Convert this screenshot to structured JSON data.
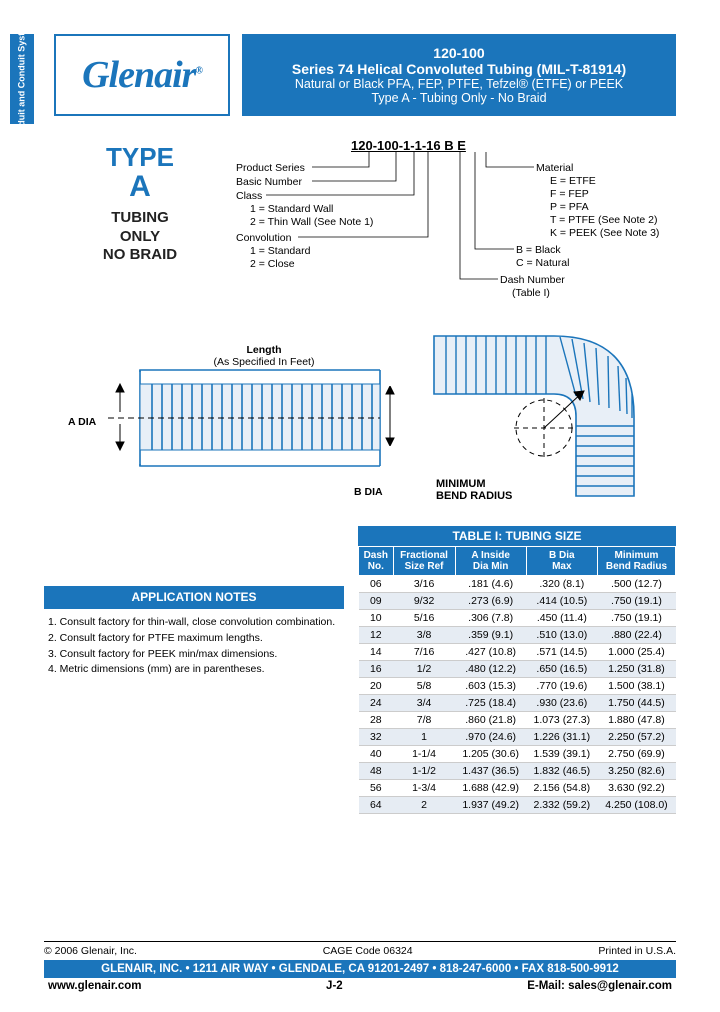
{
  "sideTab": "Conduit and\nConduit\nSystems",
  "logo": "Glenair",
  "logoReg": "®",
  "title": {
    "l1": "120-100",
    "l2": "Series 74 Helical Convoluted Tubing (MIL-T-81914)",
    "l3": "Natural or Black PFA, FEP, PTFE, Tefzel® (ETFE) or PEEK",
    "l4": "Type A - Tubing Only - No Braid"
  },
  "typeA": {
    "line1": "TYPE",
    "line2": "A",
    "line3": "TUBING",
    "line4": "ONLY",
    "line5": "NO BRAID"
  },
  "pn": {
    "example": "120-100-1-1-16 B E",
    "labels": {
      "productSeries": "Product Series",
      "basicNumber": "Basic Number",
      "class": "Class",
      "class1": "1 = Standard Wall",
      "class2": "2 = Thin Wall (See Note 1)",
      "convolution": "Convolution",
      "conv1": "1 = Standard",
      "conv2": "2 = Close",
      "material": "Material",
      "matE": "E = ETFE",
      "matF": "F = FEP",
      "matP": "P = PFA",
      "matT": "T = PTFE (See Note 2)",
      "matK": "K = PEEK (See Note 3)",
      "colorB": "B = Black",
      "colorC": "C = Natural",
      "dashNum": "Dash Number",
      "dashNumRef": "(Table I)"
    }
  },
  "diag": {
    "lengthLabel": "Length",
    "lengthSub": "(As Specified In Feet)",
    "aDia": "A DIA",
    "bDia": "B DIA",
    "bendLabel": "MINIMUM\nBEND RADIUS"
  },
  "notes": {
    "header": "APPLICATION NOTES",
    "items": [
      "1. Consult factory for thin-wall, close convolution combination.",
      "2. Consult factory for PTFE maximum lengths.",
      "3. Consult factory for PEEK min/max dimensions.",
      "4. Metric dimensions (mm) are in parentheses."
    ]
  },
  "table": {
    "caption": "TABLE I: TUBING SIZE",
    "headers": [
      "Dash\nNo.",
      "Fractional\nSize Ref",
      "A Inside\nDia Min",
      "B Dia\nMax",
      "Minimum\nBend Radius"
    ],
    "rows": [
      [
        "06",
        "3/16",
        ".181 (4.6)",
        ".320 (8.1)",
        ".500 (12.7)"
      ],
      [
        "09",
        "9/32",
        ".273 (6.9)",
        ".414 (10.5)",
        ".750 (19.1)"
      ],
      [
        "10",
        "5/16",
        ".306 (7.8)",
        ".450 (11.4)",
        ".750 (19.1)"
      ],
      [
        "12",
        "3/8",
        ".359 (9.1)",
        ".510 (13.0)",
        ".880 (22.4)"
      ],
      [
        "14",
        "7/16",
        ".427 (10.8)",
        ".571 (14.5)",
        "1.000 (25.4)"
      ],
      [
        "16",
        "1/2",
        ".480 (12.2)",
        ".650 (16.5)",
        "1.250 (31.8)"
      ],
      [
        "20",
        "5/8",
        ".603 (15.3)",
        ".770 (19.6)",
        "1.500 (38.1)"
      ],
      [
        "24",
        "3/4",
        ".725 (18.4)",
        ".930 (23.6)",
        "1.750 (44.5)"
      ],
      [
        "28",
        "7/8",
        ".860 (21.8)",
        "1.073 (27.3)",
        "1.880 (47.8)"
      ],
      [
        "32",
        "1",
        ".970 (24.6)",
        "1.226 (31.1)",
        "2.250 (57.2)"
      ],
      [
        "40",
        "1-1/4",
        "1.205 (30.6)",
        "1.539 (39.1)",
        "2.750 (69.9)"
      ],
      [
        "48",
        "1-1/2",
        "1.437 (36.5)",
        "1.832 (46.5)",
        "3.250 (82.6)"
      ],
      [
        "56",
        "1-3/4",
        "1.688 (42.9)",
        "2.156 (54.8)",
        "3.630 (92.2)"
      ],
      [
        "64",
        "2",
        "1.937 (49.2)",
        "2.332 (59.2)",
        "4.250 (108.0)"
      ]
    ]
  },
  "footer": {
    "copyright": "© 2006 Glenair, Inc.",
    "cage": "CAGE Code 06324",
    "printed": "Printed in U.S.A.",
    "bar": "GLENAIR, INC. • 1211 AIR WAY • GLENDALE, CA 91201-2497 • 818-247-6000 • FAX 818-500-9912",
    "web": "www.glenair.com",
    "page": "J-2",
    "email": "E-Mail: sales@glenair.com"
  }
}
